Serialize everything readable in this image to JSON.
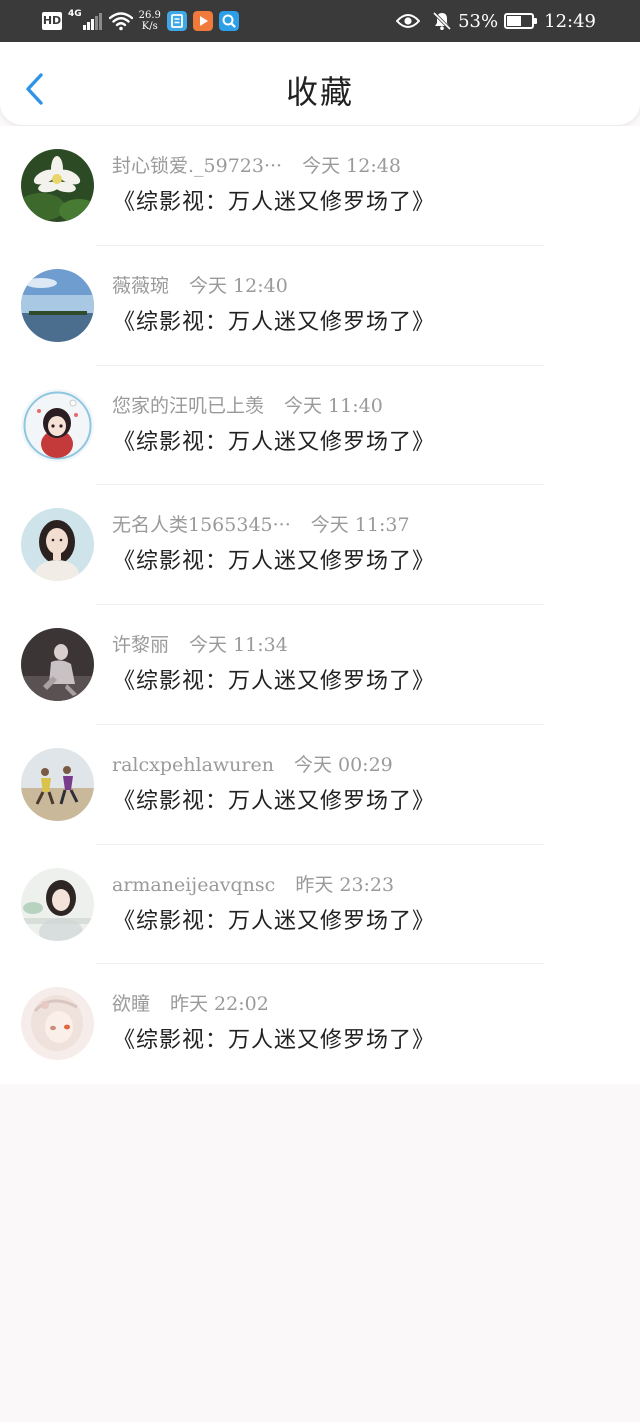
{
  "status_bar": {
    "hd_label": "HD",
    "network_type": "4G",
    "speed_value": "26.9",
    "speed_unit": "K/s",
    "battery_percent": "53%",
    "battery_level": 0.53,
    "time": "12:49",
    "colors": {
      "background": "#3a3a3a",
      "app1": "#3fa7e6",
      "app2": "#f07a3b",
      "app3": "#2d9ee8"
    }
  },
  "header": {
    "title": "收藏",
    "back_icon": "chevron-left-icon",
    "accent_color": "#2f93e8"
  },
  "favorites": [
    {
      "user": "封心锁爱._59723···",
      "time": "今天  12:48",
      "message": "《综影视：万人迷又修罗场了》"
    },
    {
      "user": "薇薇琬",
      "time": "今天  12:40",
      "message": "《综影视：万人迷又修罗场了》"
    },
    {
      "user": "您家的汪叽已上羡",
      "time": "今天  11:40",
      "message": "《综影视：万人迷又修罗场了》"
    },
    {
      "user": "无名人类1565345···",
      "time": "今天  11:37",
      "message": "《综影视：万人迷又修罗场了》"
    },
    {
      "user": "许黎丽",
      "time": "今天  11:34",
      "message": "《综影视：万人迷又修罗场了》"
    },
    {
      "user": "ralcxpehlawuren",
      "time": "今天  00:29",
      "message": "《综影视：万人迷又修罗场了》"
    },
    {
      "user": "armaneijeavqnsc",
      "time": "昨天  23:23",
      "message": "《综影视：万人迷又修罗场了》"
    },
    {
      "user": "欲瞳",
      "time": "昨天  22:02",
      "message": "《综影视：万人迷又修罗场了》"
    }
  ]
}
